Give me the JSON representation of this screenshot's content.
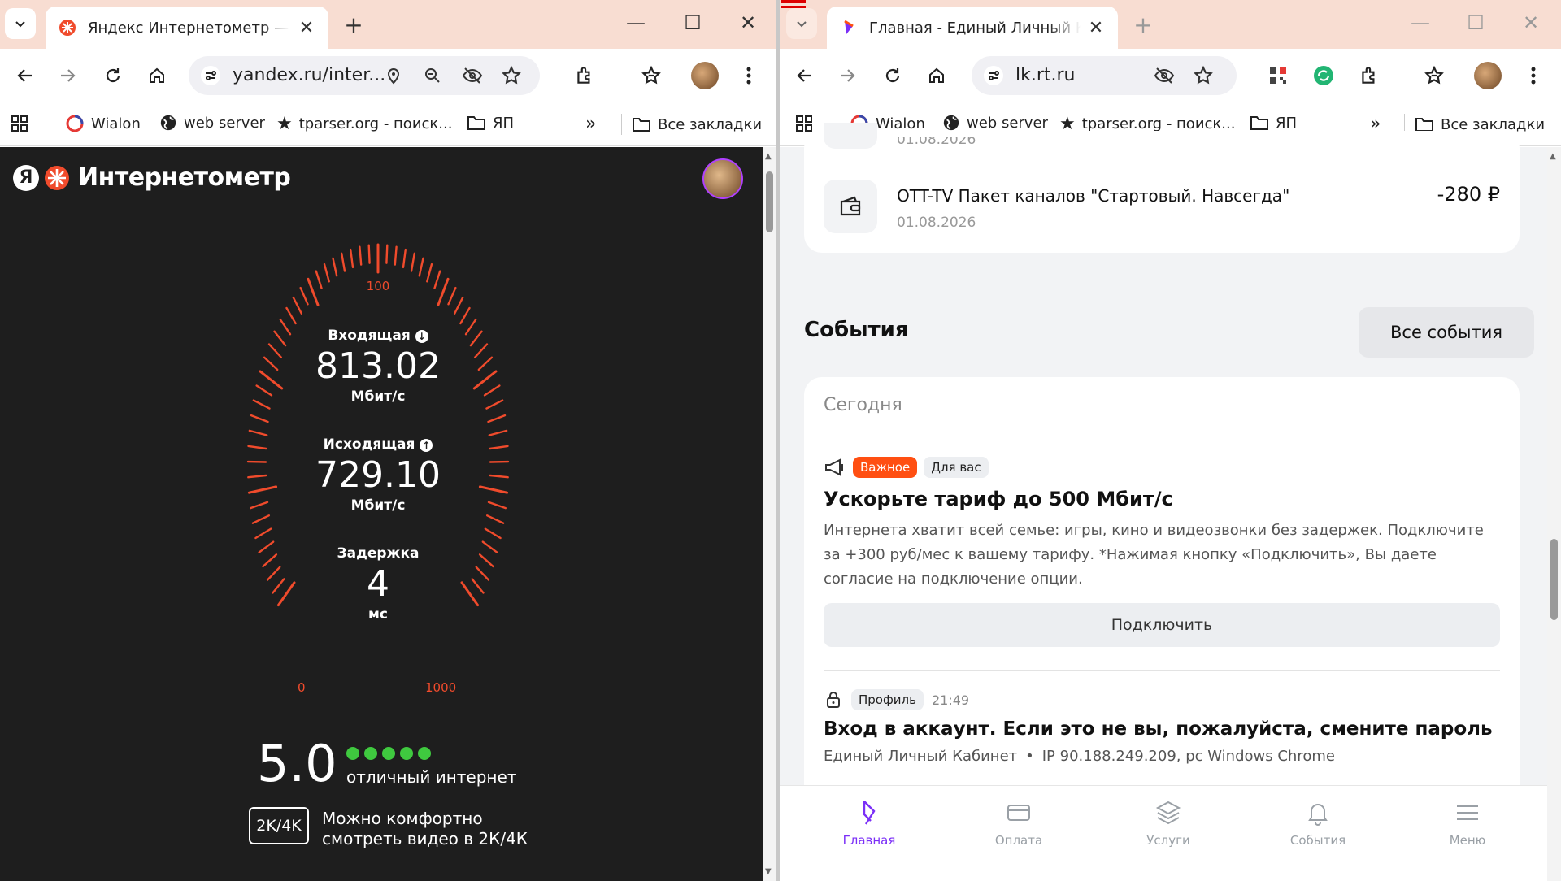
{
  "left": {
    "tab_title": "Яндекс Интернетометр — про",
    "url": "yandex.ru/inter...",
    "bookmarks": [
      "Wialon",
      "web server",
      "tparser.org - поиск...",
      "ЯП"
    ],
    "all_bookmarks": "Все закладки",
    "brand": "Интернетометр",
    "brand_letter": "Я",
    "gauge": {
      "label_100": "100",
      "label_0": "0",
      "label_1000": "1000"
    },
    "download": {
      "label": "Входящая",
      "value": "813.02",
      "unit": "Мбит/с"
    },
    "upload": {
      "label": "Исходящая",
      "value": "729.10",
      "unit": "Мбит/с"
    },
    "latency": {
      "label": "Задержка",
      "value": "4",
      "unit": "мс"
    },
    "score": {
      "value": "5.0",
      "dots": 5,
      "text": "отличный интернет"
    },
    "video": {
      "badge": "2K/4K",
      "line1": "Можно комфортно",
      "line2": "смотреть видео в 2К/4К"
    },
    "accent": "#f04b2c"
  },
  "right": {
    "tab_title": "Главная - Единый Личный Каб",
    "url": "lk.rt.ru",
    "bookmarks": [
      "Wialon",
      "web server",
      "tparser.org - поиск...",
      "ЯП"
    ],
    "all_bookmarks": "Все закладки",
    "prev_date": "01.08.2026",
    "payment": {
      "title": "OTT-TV Пакет каналов \"Стартовый. Навсегда\"",
      "date": "01.08.2026",
      "amount": "-280 ₽"
    },
    "events": {
      "title": "События",
      "all_button": "Все события",
      "today": "Сегодня"
    },
    "event1": {
      "tag1": "Важное",
      "tag2": "Для вас",
      "title": "Ускорьте тариф до 500 Мбит/с",
      "body": "Интернета хватит всей семье: игры, кино и видеозвонки без задержек. Подключите за +300 руб/мес к вашему тарифу. *Нажимая кнопку «Подключить», Вы даете согласие на подключение опции.",
      "button": "Подключить"
    },
    "event2": {
      "tag": "Профиль",
      "time": "21:49",
      "title": "Вход в аккаунт. Если это не вы, пожалуйста, смените пароль",
      "source": "Единый Личный Кабинет",
      "sep": "•",
      "detail": "IP 90.188.249.209, pc Windows Chrome"
    },
    "nav": [
      "Главная",
      "Оплата",
      "Услуги",
      "События",
      "Меню"
    ],
    "accent": "#7b2ff7"
  }
}
